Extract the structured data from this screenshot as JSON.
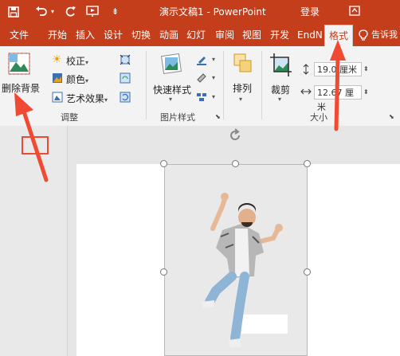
{
  "titlebar": {
    "title": "演示文稿1  -  PowerPoint",
    "login": "登录",
    "icons": [
      "save-icon",
      "undo-icon",
      "redo-icon",
      "present-icon",
      "customize-icon",
      "ribbon-display-icon"
    ]
  },
  "tabs": [
    "文件",
    "开始",
    "插入",
    "设计",
    "切换",
    "动画",
    "幻灯",
    "审阅",
    "视图",
    "开发",
    "EndN",
    "格式"
  ],
  "active_tab": "格式",
  "tell_me": "告诉我",
  "ribbon": {
    "remove_bg": "删除背景",
    "adjust": {
      "corrections": "校正",
      "color": "颜色",
      "artistic": "艺术效果",
      "group_label": "调整"
    },
    "picture_styles": {
      "quick_styles": "快速样式",
      "group_label": "图片样式"
    },
    "arrange": {
      "label": "排列"
    },
    "size": {
      "crop": "裁剪",
      "height": "19.0",
      "width": "12.67",
      "unit": "厘米",
      "group_label": "大小"
    }
  },
  "colors": {
    "accent": "#c43e1c",
    "annotation": "#f04a32"
  }
}
